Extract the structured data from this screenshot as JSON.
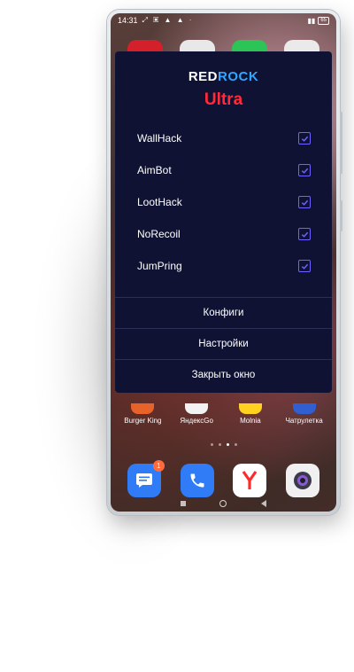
{
  "statusbar": {
    "time": "14:31",
    "icons": "⤢ ▣ ▲ ▲ ·",
    "battery": "65"
  },
  "menu": {
    "brand_part1": "RED",
    "brand_part2": "ROCK",
    "edition": "Ultra",
    "options": [
      {
        "label": "WallHack",
        "checked": true
      },
      {
        "label": "AimBot",
        "checked": true
      },
      {
        "label": "LootHack",
        "checked": true
      },
      {
        "label": "NoRecoil",
        "checked": true
      },
      {
        "label": "JumPring",
        "checked": true
      }
    ],
    "buttons": {
      "configs": "Конфиги",
      "settings": "Настройки",
      "close": "Закрыть окно"
    },
    "colors": {
      "background": "#0f1233",
      "checkbox": "#6f63ff",
      "accent_red": "#ff2a3a",
      "accent_blue": "#2fa6ff"
    }
  },
  "home": {
    "apps": [
      {
        "label": "Burger King",
        "color": "#e8632a"
      },
      {
        "label": "ЯндексGo",
        "color": "#f2f2f2"
      },
      {
        "label": "Molnia",
        "color": "#ffd21f"
      },
      {
        "label": "Чатрулетка",
        "color": "#2f5fd0"
      }
    ],
    "dock": [
      {
        "icon": "messages-icon",
        "color": "#2f7cf6",
        "badge": "1"
      },
      {
        "icon": "phone-icon",
        "color": "#2f7cf6"
      },
      {
        "icon": "yandex-browser-icon",
        "color": "#ffffff"
      },
      {
        "icon": "camera-icon",
        "color": "#f0f0f0"
      }
    ]
  }
}
